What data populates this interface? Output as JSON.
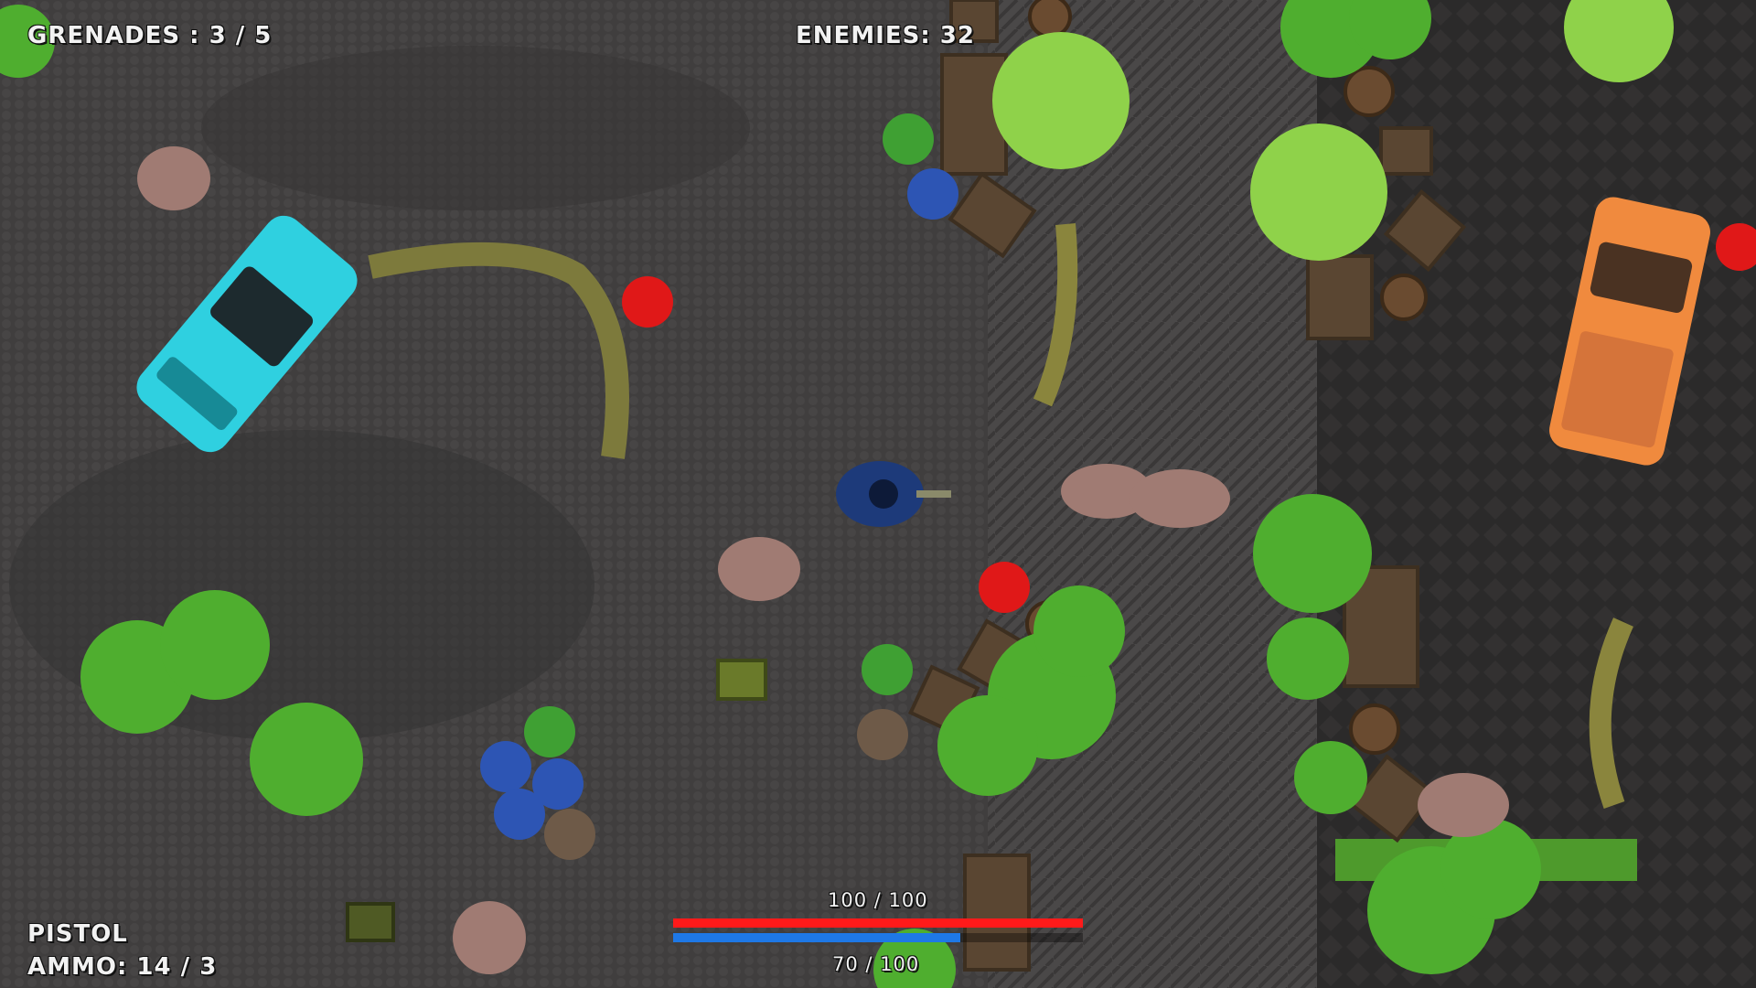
{
  "hud": {
    "grenades_text": "GRENADES : 3 / 5",
    "enemies_text": "ENEMIES: 32",
    "weapon_name": "PISTOL",
    "ammo_text": "AMMO: 14 / 3",
    "health_text": "100 / 100",
    "stamina_text": "70 / 100"
  },
  "bars": {
    "health": {
      "current": 100,
      "max": 100,
      "color": "#ff1a1a"
    },
    "stamina": {
      "current": 70,
      "max": 100,
      "color": "#1e78e6"
    }
  },
  "colors": {
    "ground": "#3e3c3c",
    "paving": "#4a4848",
    "parking_lot": "#2c2c2c",
    "foliage": "#4fae2f",
    "palm": "#8fd24a",
    "crate": "#5a4632",
    "car_cyan": "#2fd0e0",
    "car_orange": "#f08a3e"
  }
}
